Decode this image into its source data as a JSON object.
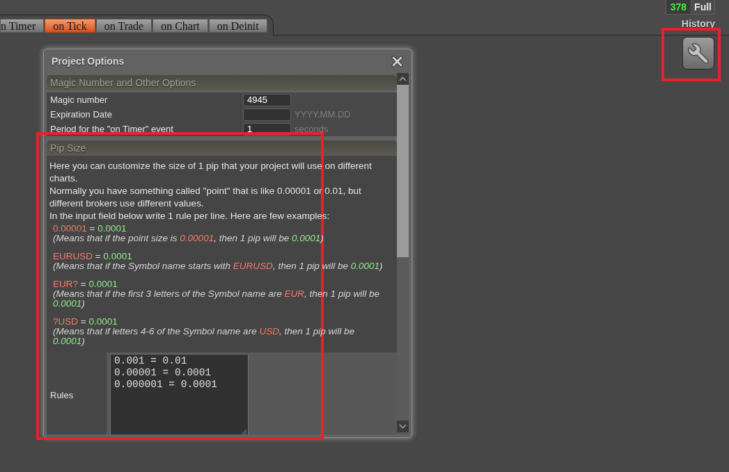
{
  "tabs": [
    {
      "label": "n Timer",
      "selected": false
    },
    {
      "label": "on Tick",
      "selected": true
    },
    {
      "label": "on Trade",
      "selected": false
    },
    {
      "label": "on Chart",
      "selected": false
    },
    {
      "label": "on Deinit",
      "selected": false
    }
  ],
  "counter": {
    "value": "378",
    "label": "Full"
  },
  "history": {
    "label": "History"
  },
  "tool_button": {
    "highlighted": true
  },
  "dialog": {
    "title": "Project Options",
    "sections": [
      {
        "kind": "fields",
        "title": "Magic Number and Other Options",
        "rows": [
          {
            "label": "Magic number",
            "value": "4945"
          },
          {
            "label": "Expiration Date",
            "hint": "YYYY.MM.DD"
          },
          {
            "label": "Period for the \"on Timer\" event",
            "value": "1",
            "hint": "seconds"
          }
        ]
      },
      {
        "kind": "help",
        "title": "Pip Size",
        "highlighted": true,
        "paragraphs": [
          "Here you can customize the size of 1 pip that your project will use on different charts.",
          "Normally you have something called \"point\" that is like 0.00001 or 0.01, but different brokers use different values.",
          "In the input field below write 1 rule per line. Here are few examples:"
        ],
        "examples": [
          {
            "rule": [
              {
                "text": "0.00001",
                "kind": "pattern"
              },
              {
                "text": " = ",
                "kind": "plain"
              },
              {
                "text": "0.0001",
                "kind": "pip"
              }
            ],
            "note": [
              {
                "text": "(Means that if the point size is ",
                "kind": "plain"
              },
              {
                "text": "0.00001",
                "kind": "pattern"
              },
              {
                "text": ", then 1 pip will be ",
                "kind": "plain"
              },
              {
                "text": "0.0001",
                "kind": "pip"
              },
              {
                "text": ")",
                "kind": "plain"
              }
            ]
          },
          {
            "rule": [
              {
                "text": "EURUSD",
                "kind": "pattern"
              },
              {
                "text": " = ",
                "kind": "plain"
              },
              {
                "text": "0.0001",
                "kind": "pip"
              }
            ],
            "note": [
              {
                "text": "(Means that if the Symbol name starts with ",
                "kind": "plain"
              },
              {
                "text": "EURUSD",
                "kind": "pattern"
              },
              {
                "text": ", then 1 pip will be ",
                "kind": "plain"
              },
              {
                "text": "0.0001",
                "kind": "pip"
              },
              {
                "text": ")",
                "kind": "plain"
              }
            ]
          },
          {
            "rule": [
              {
                "text": "EUR?",
                "kind": "pattern"
              },
              {
                "text": " = ",
                "kind": "plain"
              },
              {
                "text": "0.0001",
                "kind": "pip"
              }
            ],
            "note": [
              {
                "text": "(Means that if the first 3 letters of the Symbol name are ",
                "kind": "plain"
              },
              {
                "text": "EUR",
                "kind": "pattern"
              },
              {
                "text": ", then 1 pip will be ",
                "kind": "plain"
              },
              {
                "text": "0.0001",
                "kind": "pip"
              },
              {
                "text": ")",
                "kind": "plain"
              }
            ]
          },
          {
            "rule": [
              {
                "text": "?USD",
                "kind": "pattern"
              },
              {
                "text": " = ",
                "kind": "plain"
              },
              {
                "text": "0.0001",
                "kind": "pip"
              }
            ],
            "note": [
              {
                "text": "(Means that if letters 4-6 of the Symbol name are ",
                "kind": "plain"
              },
              {
                "text": "USD",
                "kind": "pattern"
              },
              {
                "text": ", then 1 pip will be ",
                "kind": "plain"
              },
              {
                "text": "0.0001",
                "kind": "pip"
              },
              {
                "text": ")",
                "kind": "plain"
              }
            ]
          }
        ],
        "field": {
          "label": "Rules",
          "value": "0.001 = 0.01\n0.00001 = 0.0001\n0.000001 = 0.0001"
        }
      }
    ]
  }
}
